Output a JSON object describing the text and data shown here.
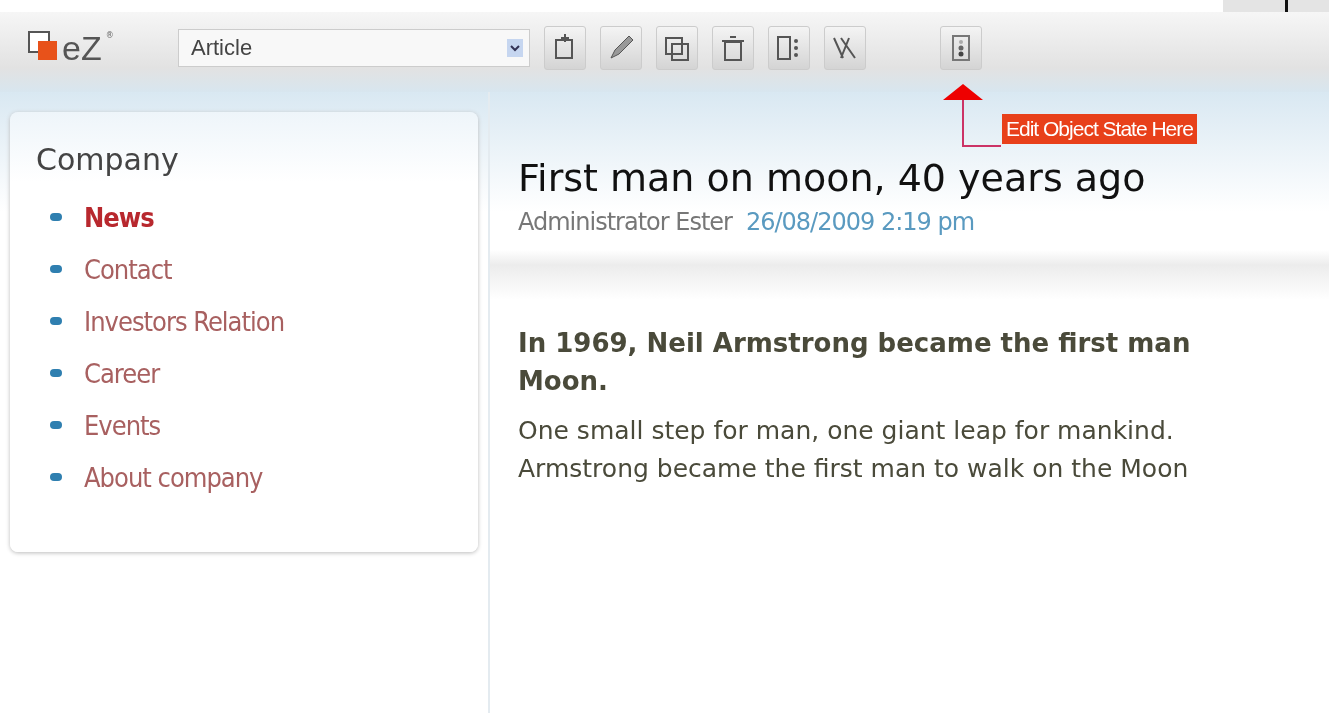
{
  "toolbar": {
    "logo_text": "eZ",
    "logo_mark": "®",
    "class_select": {
      "value": "Article"
    },
    "tools": [
      {
        "kind": "create"
      },
      {
        "kind": "edit"
      },
      {
        "kind": "copy"
      },
      {
        "kind": "delete"
      },
      {
        "kind": "sort"
      },
      {
        "kind": "translate"
      },
      {
        "kind": "state"
      }
    ]
  },
  "annotation": {
    "label": "Edit Object State Here"
  },
  "sidebar": {
    "title": "Company",
    "items": [
      {
        "label": "News",
        "selected": true
      },
      {
        "label": "Contact",
        "selected": false
      },
      {
        "label": "Investors Relation",
        "selected": false
      },
      {
        "label": "Career",
        "selected": false
      },
      {
        "label": "Events",
        "selected": false
      },
      {
        "label": "About company",
        "selected": false
      }
    ]
  },
  "article": {
    "title": "First man on moon, 40 years ago",
    "author": "Administrator Ester",
    "date": "26/08/2009 2:19 pm",
    "intro_lines": [
      "In 1969, Neil Armstrong became the first man",
      "Moon."
    ],
    "body_lines": [
      "One small step for man, one giant leap for mankind.",
      "Armstrong became the first man to walk on the Moon"
    ]
  }
}
